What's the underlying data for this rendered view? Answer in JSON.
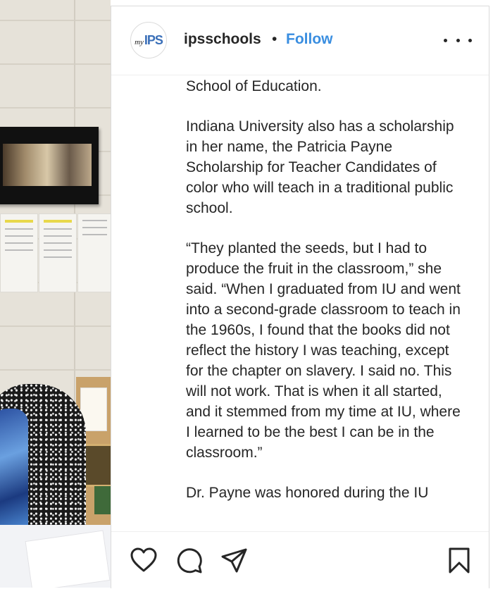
{
  "post": {
    "username": "ipsschools",
    "separator": "•",
    "follow_label": "Follow",
    "avatar_logo": {
      "prefix": "my",
      "name": "IPS"
    },
    "caption_paragraphs": [
      "School of Education.",
      "Indiana University also has a scholarship in her name, the Patricia Payne Scholarship for Teacher Candidates of color who will teach in a traditional public school.",
      "“They planted the seeds, but I had to produce the fruit in the classroom,” she said. “When I graduated from IU and went into a second-grade classroom to teach in the 1960s, I found that the books did not reflect the history I was teaching, except for the chapter on slavery. I said no. This will not work. That is when it all started, and it stemmed from my time at IU, where I learned to be the best I can be in the classroom.”",
      "Dr. Payne was honored during the IU"
    ]
  },
  "icons": {
    "more": "more-options-icon",
    "like": "heart-icon",
    "comment": "comment-icon",
    "share": "share-icon",
    "save": "bookmark-icon"
  },
  "colors": {
    "text": "#262626",
    "follow": "#3a8ee0",
    "logo_blue": "#3a6fb8",
    "border": "#dbdbdb"
  }
}
